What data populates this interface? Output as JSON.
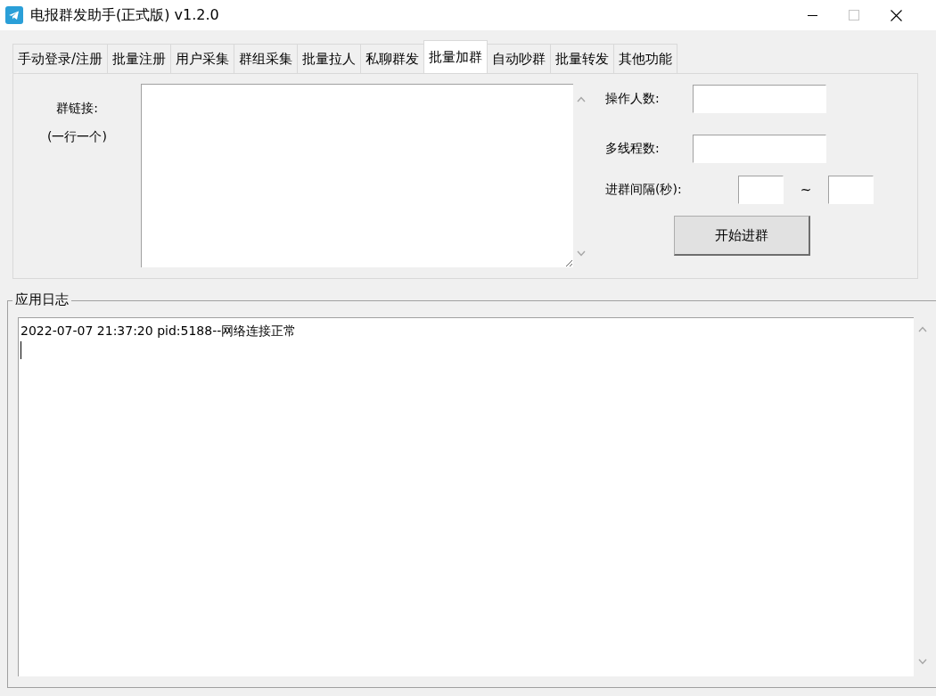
{
  "window": {
    "title": "电报群发助手(正式版) v1.2.0"
  },
  "tabs": [
    {
      "label": "手动登录/注册",
      "selected": false
    },
    {
      "label": "批量注册",
      "selected": false
    },
    {
      "label": "用户采集",
      "selected": false
    },
    {
      "label": "群组采集",
      "selected": false
    },
    {
      "label": "批量拉人",
      "selected": false
    },
    {
      "label": "私聊群发",
      "selected": false
    },
    {
      "label": "批量加群",
      "selected": true
    },
    {
      "label": "自动吵群",
      "selected": false
    },
    {
      "label": "批量转发",
      "selected": false
    },
    {
      "label": "其他功能",
      "selected": false
    }
  ],
  "join_panel": {
    "links_label": "群链接:",
    "links_hint": "(一行一个)",
    "operator_count": {
      "label": "操作人数:"
    },
    "thread_count": {
      "label": "多线程数:"
    },
    "interval": {
      "label": "进群间隔(秒):",
      "separator": "~"
    },
    "start_button": "开始进群"
  },
  "log": {
    "title": "应用日志",
    "lines": [
      "2022-07-07 21:37:20 pid:5188--网络连接正常"
    ]
  }
}
